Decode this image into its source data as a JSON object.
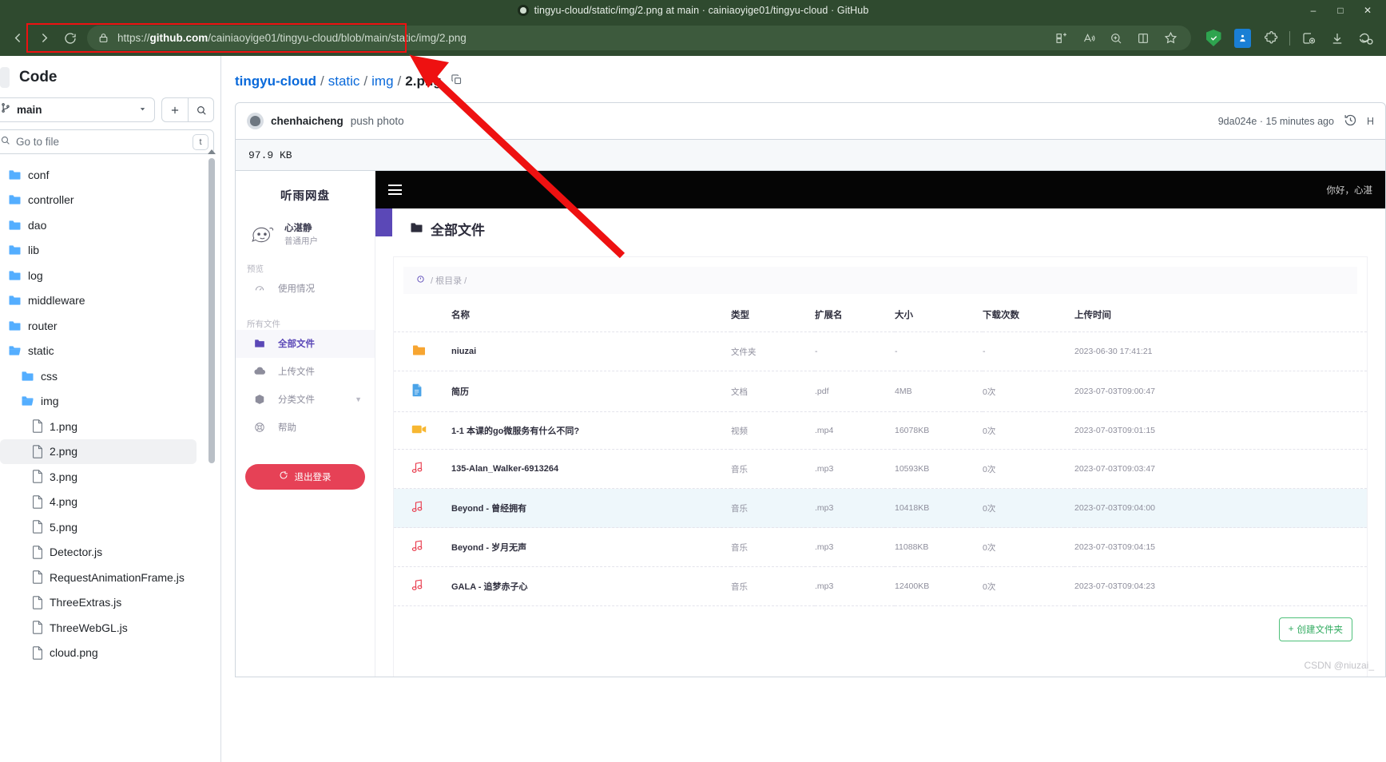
{
  "browser": {
    "title": "tingyu-cloud/static/img/2.png at main · cainiaoyige01/tingyu-cloud · GitHub",
    "url_prefix": "https://",
    "url_domain": "github.com",
    "url_path": "/cainiaoyige01/tingyu-cloud/blob/main/static/img/2.png",
    "window_controls": [
      "minimize-icon",
      "maximize-icon",
      "close-icon"
    ],
    "nav_icons": [
      "back-icon",
      "forward-icon",
      "refresh-icon"
    ],
    "url_action_icons": [
      "split-screen-icon",
      "read-aloud-icon",
      "zoom-icon",
      "reading-view-icon",
      "favorite-icon"
    ],
    "toolbar_icons": [
      "adblock-shield-icon",
      "extension-blue-icon",
      "extensions-puzzle-icon",
      "collections-icon",
      "downloads-icon",
      "browser-essentials-icon"
    ],
    "accent_color": "#2f4a2f"
  },
  "sidebar": {
    "title": "Code",
    "branch": "main",
    "branch_icon": "branch-icon",
    "add_label": "+",
    "search_icon": "search-icon",
    "search_placeholder": "Go to file",
    "search_kbd": "t",
    "tree": [
      {
        "label": "conf",
        "type": "folder",
        "indent": 0,
        "selected": false
      },
      {
        "label": "controller",
        "type": "folder",
        "indent": 0,
        "selected": false
      },
      {
        "label": "dao",
        "type": "folder",
        "indent": 0,
        "selected": false
      },
      {
        "label": "lib",
        "type": "folder",
        "indent": 0,
        "selected": false
      },
      {
        "label": "log",
        "type": "folder",
        "indent": 0,
        "selected": false
      },
      {
        "label": "middleware",
        "type": "folder",
        "indent": 0,
        "selected": false
      },
      {
        "label": "router",
        "type": "folder",
        "indent": 0,
        "selected": false
      },
      {
        "label": "static",
        "type": "folder-open",
        "indent": 0,
        "selected": false
      },
      {
        "label": "css",
        "type": "folder",
        "indent": 1,
        "selected": false
      },
      {
        "label": "img",
        "type": "folder-open",
        "indent": 1,
        "selected": false
      },
      {
        "label": "1.png",
        "type": "file",
        "indent": 2,
        "selected": false
      },
      {
        "label": "2.png",
        "type": "file",
        "indent": 2,
        "selected": true
      },
      {
        "label": "3.png",
        "type": "file",
        "indent": 2,
        "selected": false
      },
      {
        "label": "4.png",
        "type": "file",
        "indent": 2,
        "selected": false
      },
      {
        "label": "5.png",
        "type": "file",
        "indent": 2,
        "selected": false
      },
      {
        "label": "Detector.js",
        "type": "file",
        "indent": 2,
        "selected": false
      },
      {
        "label": "RequestAnimationFrame.js",
        "type": "file",
        "indent": 2,
        "selected": false
      },
      {
        "label": "ThreeExtras.js",
        "type": "file",
        "indent": 2,
        "selected": false
      },
      {
        "label": "ThreeWebGL.js",
        "type": "file",
        "indent": 2,
        "selected": false
      },
      {
        "label": "cloud.png",
        "type": "file",
        "indent": 2,
        "selected": false
      }
    ]
  },
  "main": {
    "breadcrumb": {
      "repo": "tingyu-cloud",
      "sep": "/",
      "parts": [
        "static",
        "img"
      ],
      "current": "2.png",
      "copy_icon": "copy-path-icon"
    },
    "commit": {
      "author": "chenhaicheng",
      "message": "push photo",
      "hash": "9da024e",
      "time": "15 minutes ago",
      "hash_time": "9da024e · 15 minutes ago",
      "history_icon": "history-icon",
      "history_label": "H"
    },
    "file_size": "97.9 KB"
  },
  "screenshot": {
    "brand": "听雨网盘",
    "user": {
      "name": "心湛静",
      "role": "普通用户",
      "avatar_icon": "cartoon-avatar-icon"
    },
    "nav_groups": [
      {
        "label": "预览",
        "items": [
          {
            "label": "使用情况",
            "icon": "gauge-icon",
            "active": false,
            "chevron": false
          }
        ]
      },
      {
        "label": "所有文件",
        "items": [
          {
            "label": "全部文件",
            "icon": "folder-icon",
            "active": true,
            "chevron": false
          },
          {
            "label": "上传文件",
            "icon": "cloud-upload-icon",
            "active": false,
            "chevron": false
          },
          {
            "label": "分类文件",
            "icon": "box-icon",
            "active": false,
            "chevron": true
          },
          {
            "label": "帮助",
            "icon": "lifebuoy-icon",
            "active": false,
            "chevron": false
          }
        ]
      }
    ],
    "logout": {
      "label": "退出登录",
      "icon": "logout-icon",
      "color": "#e64156"
    },
    "topbar": {
      "menu_icon": "hamburger-icon",
      "greeting": "你好，心湛"
    },
    "page_title": "全部文件",
    "page_title_icon": "folder-icon",
    "path_crumb": {
      "home_icon": "home-icon",
      "text": "/ 根目录 /"
    },
    "table": {
      "headers": [
        "名称",
        "类型",
        "扩展名",
        "大小",
        "下载次数",
        "上传时间"
      ],
      "rows": [
        {
          "icon": "folder-icon",
          "name": "niuzai",
          "type": "文件夹",
          "ext": "-",
          "size": "-",
          "downloads": "-",
          "uploaded": "2023-06-30 17:41:21",
          "highlight": false
        },
        {
          "icon": "document-icon",
          "name": "简历",
          "type": "文档",
          "ext": ".pdf",
          "size": "4MB",
          "downloads": "0次",
          "uploaded": "2023-07-03T09:00:47",
          "highlight": false
        },
        {
          "icon": "video-icon",
          "name": "1-1 本课的go微服务有什么不同?",
          "type": "视频",
          "ext": ".mp4",
          "size": "16078KB",
          "downloads": "0次",
          "uploaded": "2023-07-03T09:01:15",
          "highlight": false
        },
        {
          "icon": "music-icon",
          "name": "135-Alan_Walker-6913264",
          "type": "音乐",
          "ext": ".mp3",
          "size": "10593KB",
          "downloads": "0次",
          "uploaded": "2023-07-03T09:03:47",
          "highlight": false
        },
        {
          "icon": "music-icon",
          "name": "Beyond - 曾经拥有",
          "type": "音乐",
          "ext": ".mp3",
          "size": "10418KB",
          "downloads": "0次",
          "uploaded": "2023-07-03T09:04:00",
          "highlight": true
        },
        {
          "icon": "music-icon",
          "name": "Beyond - 岁月无声",
          "type": "音乐",
          "ext": ".mp3",
          "size": "11088KB",
          "downloads": "0次",
          "uploaded": "2023-07-03T09:04:15",
          "highlight": false
        },
        {
          "icon": "music-icon",
          "name": "GALA - 追梦赤子心",
          "type": "音乐",
          "ext": ".mp3",
          "size": "12400KB",
          "downloads": "0次",
          "uploaded": "2023-07-03T09:04:23",
          "highlight": false
        }
      ]
    },
    "create_folder": {
      "label": "创建文件夹",
      "plus": "+"
    },
    "watermark": "CSDN @niuzai_"
  }
}
